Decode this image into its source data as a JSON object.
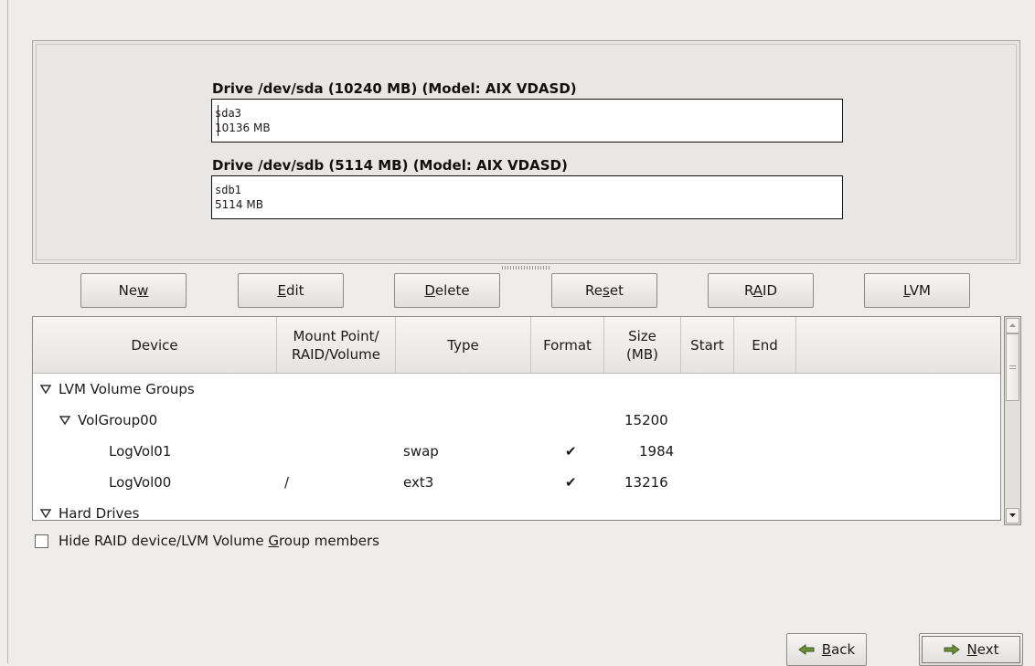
{
  "drives": [
    {
      "title": "Drive /dev/sda (10240 MB) (Model: AIX VDASD)",
      "partition": "sda3",
      "size": "10136 MB"
    },
    {
      "title": "Drive /dev/sdb (5114 MB) (Model: AIX VDASD)",
      "partition": "sdb1",
      "size": "5114 MB"
    }
  ],
  "buttons": {
    "new": {
      "pre": "Ne",
      "u": "w",
      "post": ""
    },
    "edit": {
      "pre": "",
      "u": "E",
      "post": "dit"
    },
    "delete": {
      "pre": "",
      "u": "D",
      "post": "elete"
    },
    "reset": {
      "pre": "Re",
      "u": "s",
      "post": "et"
    },
    "raid": {
      "pre": "R",
      "u": "A",
      "post": "ID"
    },
    "lvm": {
      "pre": "",
      "u": "L",
      "post": "VM"
    }
  },
  "table": {
    "headers": {
      "device": "Device",
      "mount_line1": "Mount Point/",
      "mount_line2": "RAID/Volume",
      "type": "Type",
      "format": "Format",
      "size_line1": "Size",
      "size_line2": "(MB)",
      "start": "Start",
      "end": "End"
    },
    "rows": [
      {
        "device": "LVM Volume Groups",
        "mount": "",
        "type": "",
        "format": "",
        "size": ""
      },
      {
        "device": "VolGroup00",
        "mount": "",
        "type": "",
        "format": "",
        "size": "15200"
      },
      {
        "device": "LogVol01",
        "mount": "",
        "type": "swap",
        "format": "✔",
        "size": "1984"
      },
      {
        "device": "LogVol00",
        "mount": "/",
        "type": "ext3",
        "format": "✔",
        "size": "13216"
      },
      {
        "device": "Hard Drives",
        "mount": "",
        "type": "",
        "format": "",
        "size": ""
      }
    ]
  },
  "hide_option": {
    "pre": "Hide RAID device/LVM Volume ",
    "u": "G",
    "post": "roup members"
  },
  "nav": {
    "back": {
      "pre": "",
      "u": "B",
      "post": "ack"
    },
    "next": {
      "pre": "",
      "u": "N",
      "post": "ext"
    }
  }
}
